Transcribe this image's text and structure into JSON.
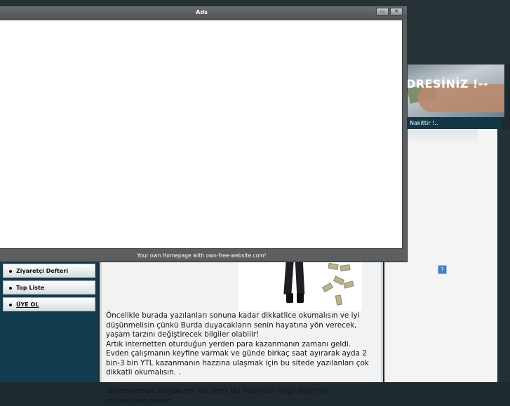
{
  "ads_window": {
    "title": "Ads",
    "footer": "Your own Homepage with own-free-website.com!",
    "buttons": [
      "▭",
      "✕"
    ]
  },
  "header": {
    "title_fragment": "DRESİNİZ !--",
    "slogan": "Nakittir !.."
  },
  "sidebar": {
    "items": [
      {
        "label": "Ziyaretçi Defteri"
      },
      {
        "label": "Top Liste"
      },
      {
        "label": "ÜYE OL"
      }
    ]
  },
  "right_column": {
    "icon": "?"
  },
  "main": {
    "paragraphs": [
      " Öncelikle burada yazılanları sonuna kadar dikkatlice okumalısın ve iyi düşünmelisin çünkü Burda duyacakların senin hayatına yön verecek, yaşam tarzını değiştirecek bilgiler olabilir!",
      "Artık internetten oturduğun yerden para kazanmanın zamanı geldi. Evden çalışmanın keyfine varmak ve günde birkaç saat ayırarak ayda 2 bin-3 bin YTL kazanmanın hazzına ulaşmak için bu sitede yazılanları çok dikkatli okumalısın. .",
      ".",
      "İnanmıyorsun biliyorum! Yok artık Bu mümkün değil diyorsun, mümkünse neden"
    ]
  }
}
